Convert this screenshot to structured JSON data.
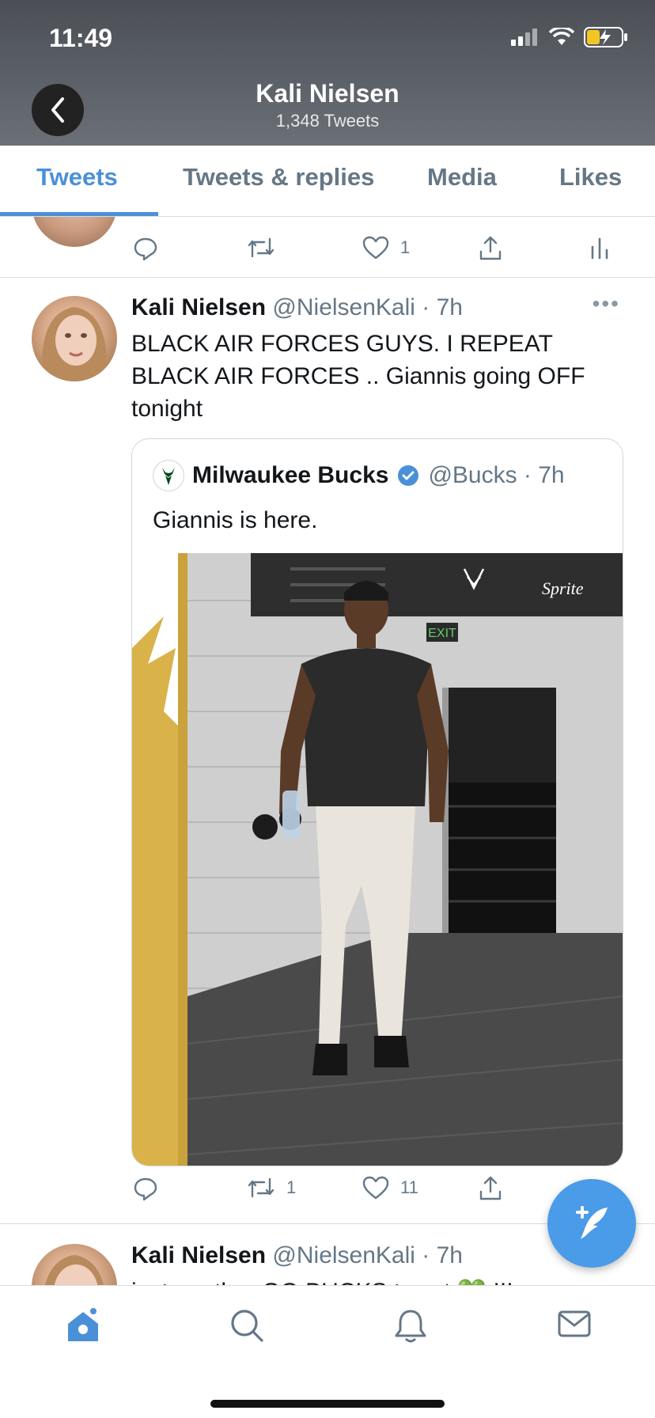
{
  "status_bar": {
    "time": "11:49"
  },
  "header": {
    "title": "Kali Nielsen",
    "subtitle": "1,348 Tweets"
  },
  "tabs": [
    {
      "label": "Tweets",
      "active": true
    },
    {
      "label": "Tweets & replies",
      "active": false
    },
    {
      "label": "Media",
      "active": false
    },
    {
      "label": "Likes",
      "active": false
    }
  ],
  "prev_tweet": {
    "like_count": "1"
  },
  "tweet": {
    "name": "Kali Nielsen",
    "meta": "@NielsenKali · 7h",
    "text_lines": [
      "BLACK AIR FORCES GUYS. I REPEAT",
      "BLACK AIR FORCES .. Giannis going OFF",
      "tonight"
    ],
    "quote": {
      "name": "Milwaukee Bucks",
      "meta": "@Bucks · 7h",
      "text": "Giannis is here.",
      "photo_sign": "EXIT",
      "photo_brand": "Sprite"
    },
    "retweet_count": "1",
    "like_count": "11"
  },
  "next_tweet": {
    "name": "Kali Nielsen",
    "meta": "@NielsenKali · 7h",
    "text_partial": "just another GO BUCKS tweet 💚 !!!"
  },
  "colors": {
    "accent": "#4a90d9",
    "fab": "#4a9be8",
    "muted": "#657786"
  }
}
